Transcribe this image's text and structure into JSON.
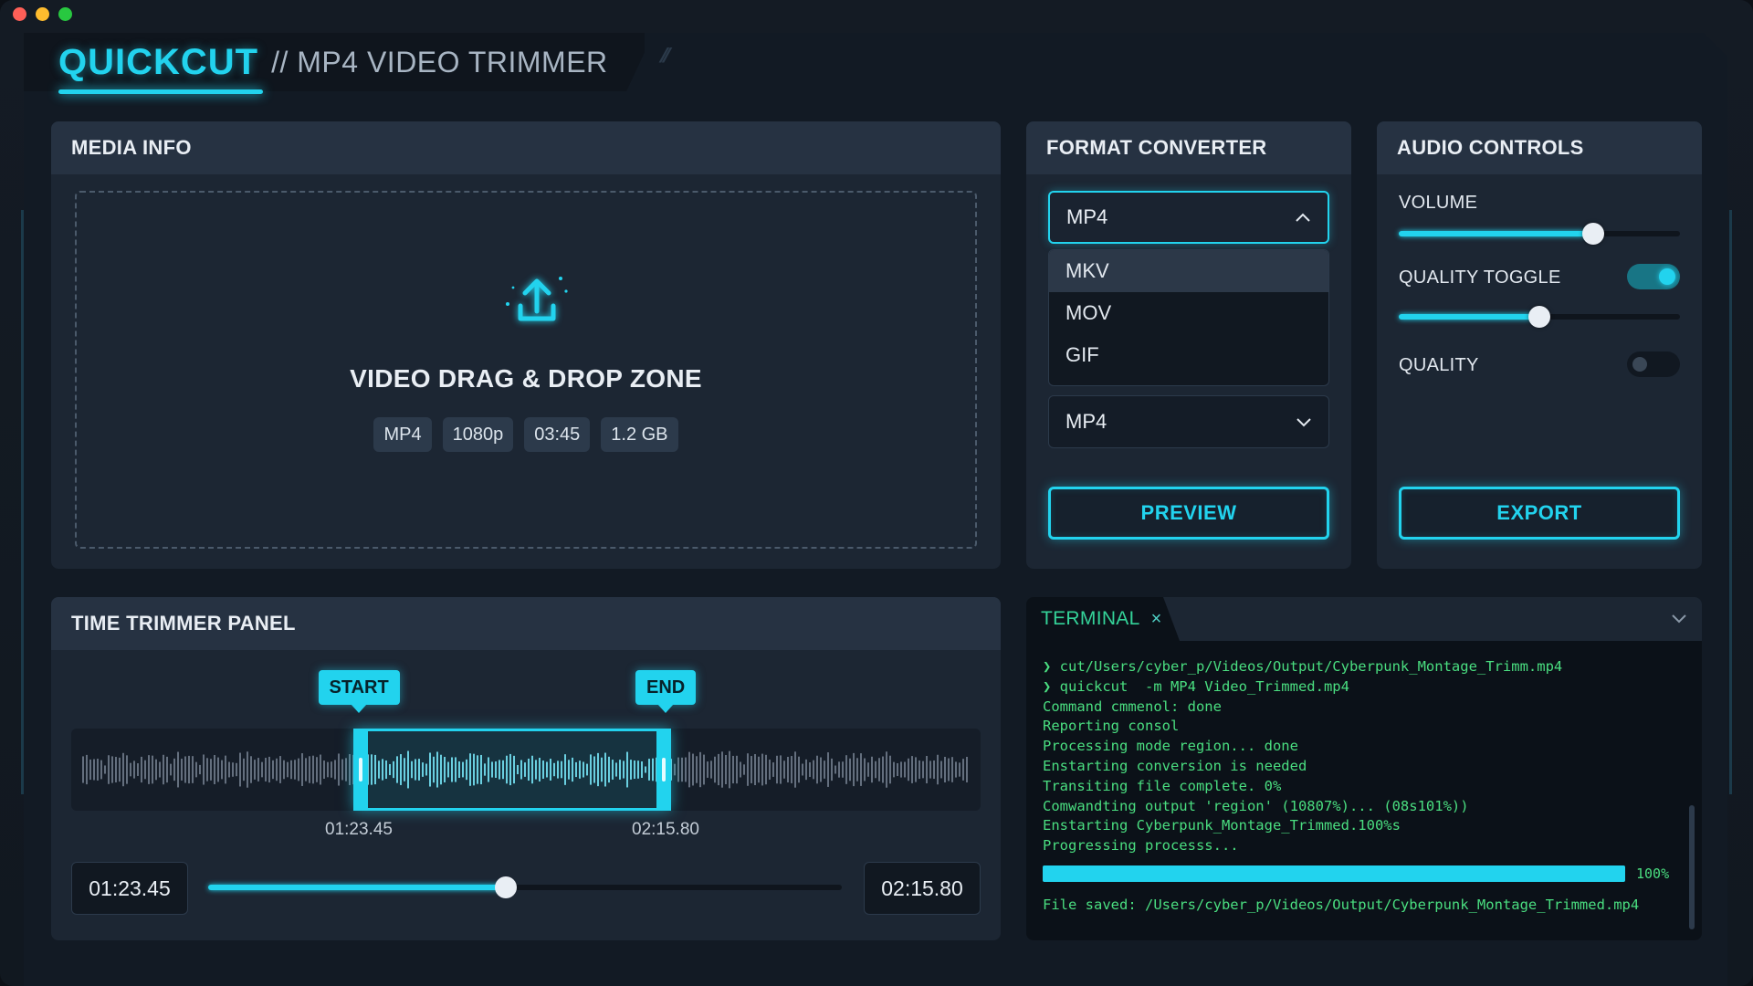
{
  "window": {
    "traffic_lights": [
      "close",
      "minimize",
      "maximize"
    ]
  },
  "header": {
    "brand": "QUICKCUT",
    "subtitle": "// MP4 VIDEO TRIMMER",
    "accent_color": "#22d3ee"
  },
  "media_info": {
    "title": "MEDIA INFO",
    "dropzone_icon": "upload-icon",
    "dropzone_label": "VIDEO DRAG & DROP ZONE",
    "chips": [
      "MP4",
      "1080p",
      "03:45",
      "1.2 GB"
    ]
  },
  "format_converter": {
    "title": "FORMAT CONVERTER",
    "open_select_value": "MP4",
    "options": [
      "MKV",
      "MOV",
      "GIF"
    ],
    "closed_select_value": "MP4",
    "preview_label": "PREVIEW"
  },
  "audio_controls": {
    "title": "AUDIO CONTROLS",
    "volume_label": "VOLUME",
    "volume_level": 0.69,
    "quality_toggle_label": "QUALITY TOGGLE",
    "quality_toggle_on": true,
    "quality_level": 0.5,
    "quality_label": "QUALITY",
    "quality_on": false,
    "export_label": "EXPORT"
  },
  "trimmer": {
    "title": "TIME TRIMMER PANEL",
    "start_marker": "START",
    "end_marker": "END",
    "start_time": "01:23.45",
    "end_time": "02:15.80",
    "start_input": "01:23.45",
    "end_input": "02:15.80",
    "selection_start_fraction": 0.31,
    "selection_end_fraction": 0.66,
    "scrub_level": 0.47
  },
  "terminal": {
    "tab_label": "TERMINAL",
    "tab_close": "×",
    "lines": [
      "❯ cut/Users/cyber_p/Videos/Output/Cyberpunk_Montage_Trimm.mp4",
      "❯ quickcut  -m MP4 Video_Trimmed.mp4",
      "Command cmmenol: done",
      "Reporting consol",
      "Processing mode region... done",
      "Enstarting conversion is needed",
      "Transiting file complete. 0%",
      "Comwandting output 'region' (10807%)... (08s101%))",
      "Enstarting Cyberpunk_Montage_Trimmed.100%s",
      "Progressing processs..."
    ],
    "progress_level": 1.0,
    "progress_label": "100%",
    "saved_line": "File saved: /Users/cyber_p/Videos/Output/Cyberpunk_Montage_Trimmed.mp4"
  }
}
